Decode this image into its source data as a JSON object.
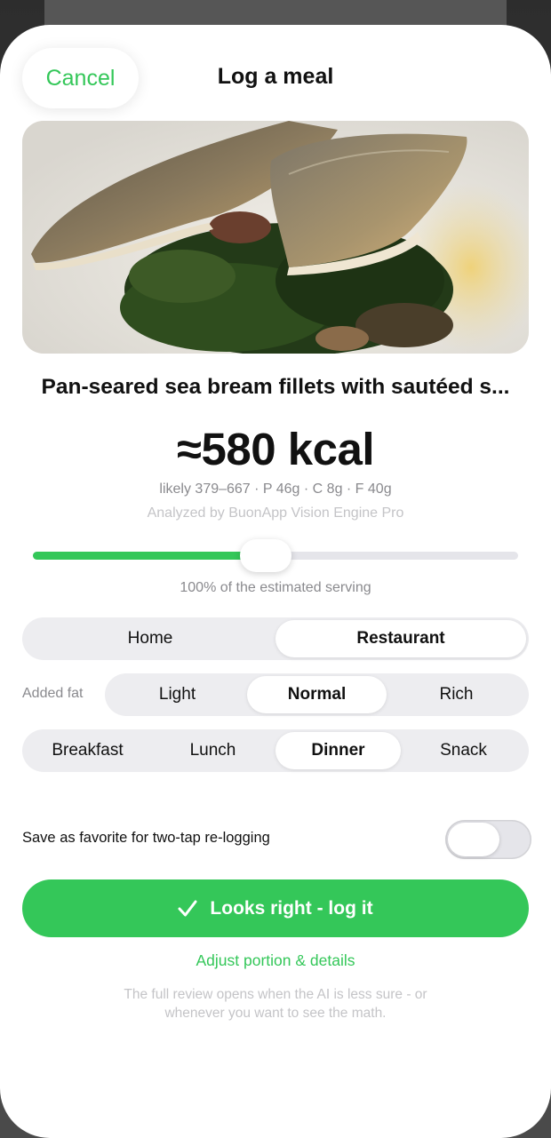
{
  "header": {
    "cancel_label": "Cancel",
    "title": "Log a meal"
  },
  "meal": {
    "name": "Pan-seared sea bream fillets with sautéed s...",
    "kcal": "≈580 kcal",
    "macros": "likely 379–667 · P 46g · C 8g · F 40g",
    "analyzed_by": "Analyzed by BuonApp Vision Engine Pro"
  },
  "serving": {
    "percent_value": 0.48,
    "label": "100% of the estimated serving"
  },
  "place": {
    "options": [
      "Home",
      "Restaurant"
    ],
    "selected": "Restaurant"
  },
  "added_fat": {
    "label": "Added fat",
    "options": [
      "Light",
      "Normal",
      "Rich"
    ],
    "selected": "Normal"
  },
  "meal_type": {
    "options": [
      "Breakfast",
      "Lunch",
      "Dinner",
      "Snack"
    ],
    "selected": "Dinner"
  },
  "favorite": {
    "label": "Save as favorite for two-tap re-logging",
    "on": false
  },
  "actions": {
    "log_label": "Looks right - log it",
    "adjust_label": "Adjust portion & details"
  },
  "footnote": {
    "line1": "The full review opens when the AI is less sure - or",
    "line2": "whenever you want to see the math."
  },
  "colors": {
    "accent": "#34c759"
  },
  "icons": {
    "log_button_icon": "checkmark-icon"
  }
}
